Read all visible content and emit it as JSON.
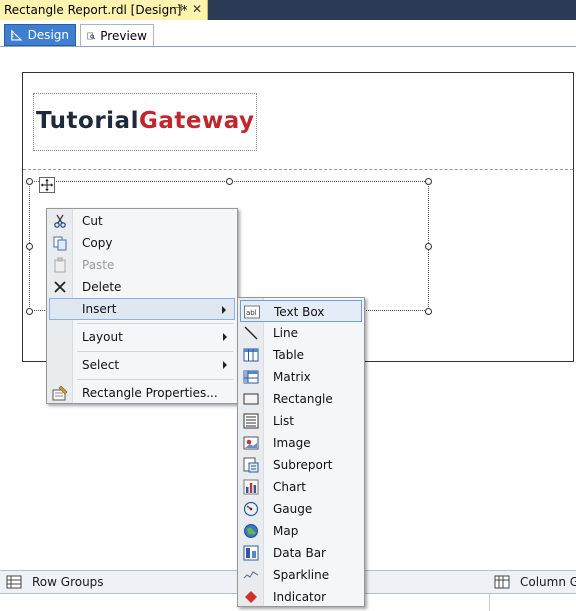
{
  "document_tab": {
    "title": "Rectangle Report.rdl [Design]*",
    "pin": "⊣",
    "close": "✕"
  },
  "view_tabs": [
    {
      "label": "Design"
    },
    {
      "label": "Preview"
    }
  ],
  "logo": {
    "part1": "Tutorial",
    "part2": "Gateway"
  },
  "context_menu": {
    "items": [
      {
        "label": "Cut",
        "icon": "scissors-icon",
        "enabled": true
      },
      {
        "label": "Copy",
        "icon": "copy-icon",
        "enabled": true
      },
      {
        "label": "Paste",
        "icon": "paste-icon",
        "enabled": false
      },
      {
        "label": "Delete",
        "icon": "delete-x-icon",
        "enabled": true
      },
      {
        "label": "Insert",
        "submenu": true,
        "highlighted": true
      },
      {
        "label": "Layout",
        "submenu": true
      },
      {
        "label": "Select",
        "submenu": true
      },
      {
        "label": "Rectangle Properties...",
        "icon": "properties-icon",
        "enabled": true
      }
    ]
  },
  "insert_submenu": {
    "items": [
      {
        "label": "Text Box",
        "icon": "textbox-icon",
        "highlighted": true
      },
      {
        "label": "Line",
        "icon": "line-icon"
      },
      {
        "label": "Table",
        "icon": "table-icon"
      },
      {
        "label": "Matrix",
        "icon": "matrix-icon"
      },
      {
        "label": "Rectangle",
        "icon": "rectangle-icon"
      },
      {
        "label": "List",
        "icon": "list-icon"
      },
      {
        "label": "Image",
        "icon": "image-icon"
      },
      {
        "label": "Subreport",
        "icon": "subreport-icon"
      },
      {
        "label": "Chart",
        "icon": "chart-icon"
      },
      {
        "label": "Gauge",
        "icon": "gauge-icon"
      },
      {
        "label": "Map",
        "icon": "map-icon"
      },
      {
        "label": "Data Bar",
        "icon": "databar-icon"
      },
      {
        "label": "Sparkline",
        "icon": "sparkline-icon"
      },
      {
        "label": "Indicator",
        "icon": "indicator-icon"
      }
    ]
  },
  "grouping_pane": {
    "row_groups": "Row Groups",
    "column_groups": "Column G"
  },
  "colors": {
    "accent": "#3f7fd0",
    "tab_bar": "#2b3a55",
    "active_doc_tab": "#fff3b0",
    "logo_dark": "#1e2a3c",
    "logo_red": "#c0272d"
  }
}
